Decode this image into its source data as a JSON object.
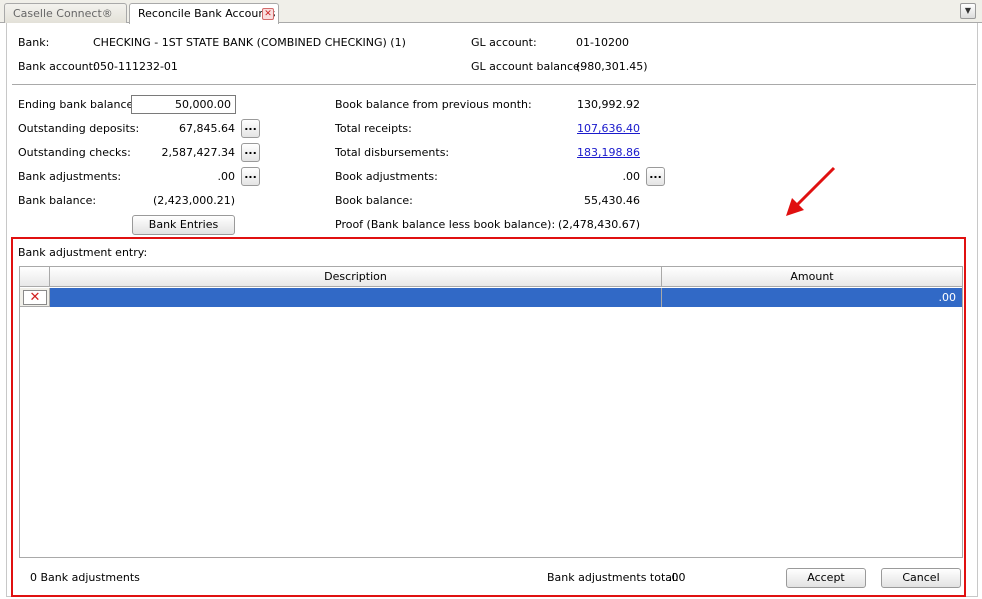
{
  "tabs": [
    {
      "label": "Caselle Connect®"
    },
    {
      "label": "Reconcile Bank Accounts"
    }
  ],
  "header": {
    "bank_label": "Bank:",
    "bank_value": "CHECKING - 1ST STATE BANK (COMBINED CHECKING) (1)",
    "bank_account_label": "Bank account:",
    "bank_account_value": "050-111232-01",
    "gl_account_label": "GL account:",
    "gl_account_value": "01-10200",
    "gl_balance_label": "GL account balance:",
    "gl_balance_value": "(980,301.45)"
  },
  "left": {
    "ending_label": "Ending bank balance:",
    "ending_value": "50,000.00",
    "out_dep_label": "Outstanding deposits:",
    "out_dep_value": "67,845.64",
    "out_chk_label": "Outstanding checks:",
    "out_chk_value": "2,587,427.34",
    "bank_adj_label": "Bank adjustments:",
    "bank_adj_value": ".00",
    "bank_bal_label": "Bank balance:",
    "bank_bal_value": "(2,423,000.21)",
    "bank_entries_button": "Bank Entries",
    "dots": "..."
  },
  "right": {
    "prev_label": "Book balance from previous month:",
    "prev_value": "130,992.92",
    "receipts_label": "Total receipts:",
    "receipts_value": "107,636.40",
    "disb_label": "Total disbursements:",
    "disb_value": "183,198.86",
    "book_adj_label": "Book adjustments:",
    "book_adj_value": ".00",
    "book_bal_label": "Book balance:",
    "book_bal_value": "55,430.46",
    "proof_label": "Proof (Bank balance less book balance):",
    "proof_value": "(2,478,430.67)"
  },
  "adjustment": {
    "section_label": "Bank adjustment entry:",
    "columns": [
      "Description",
      "Amount"
    ],
    "rows": [
      {
        "description": "",
        "amount": ".00"
      }
    ],
    "count_label": "0  Bank adjustments",
    "total_label": "Bank adjustments total:",
    "total_value": ".00",
    "accept_button": "Accept",
    "cancel_button": "Cancel"
  },
  "icons": {
    "tab_close": "close-icon",
    "tab_menu": "chevron-down-icon",
    "row_delete": "delete-x-icon",
    "annotation": "red-arrow"
  },
  "colors": {
    "selection": "#3169c6",
    "highlight_border": "#e01010",
    "link": "#1a1acc"
  }
}
